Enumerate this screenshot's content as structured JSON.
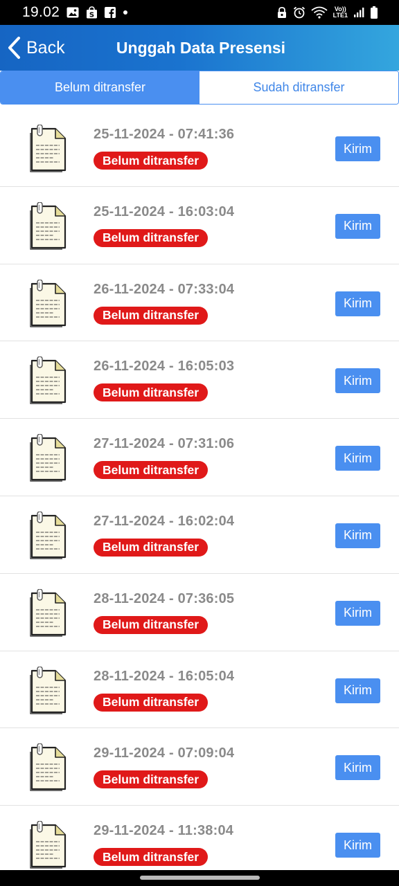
{
  "status_bar": {
    "time": "19.02",
    "network_label_top": "Vo))",
    "network_label_bottom": "LTE1",
    "icons": [
      "gallery-icon",
      "shop-icon",
      "facebook-icon",
      "dot-icon",
      "lock-icon",
      "alarm-icon",
      "wifi-icon",
      "signal-icon",
      "battery-icon"
    ]
  },
  "header": {
    "back_label": "Back",
    "title": "Unggah Data Presensi",
    "background_colors": [
      "#1665c3",
      "#34a6de"
    ]
  },
  "tabs": [
    {
      "label": "Belum ditransfer",
      "active": true
    },
    {
      "label": "Sudah ditransfer",
      "active": false
    }
  ],
  "colors": {
    "accent": "#4a8ff0",
    "badge_red": "#e01919",
    "time_gray": "#8a8a8a"
  },
  "rows": [
    {
      "datetime": "25-11-2024 - 07:41:36",
      "status": "Belum ditransfer",
      "action": "Kirim"
    },
    {
      "datetime": "25-11-2024 - 16:03:04",
      "status": "Belum ditransfer",
      "action": "Kirim"
    },
    {
      "datetime": "26-11-2024 - 07:33:04",
      "status": "Belum ditransfer",
      "action": "Kirim"
    },
    {
      "datetime": "26-11-2024 - 16:05:03",
      "status": "Belum ditransfer",
      "action": "Kirim"
    },
    {
      "datetime": "27-11-2024 - 07:31:06",
      "status": "Belum ditransfer",
      "action": "Kirim"
    },
    {
      "datetime": "27-11-2024 - 16:02:04",
      "status": "Belum ditransfer",
      "action": "Kirim"
    },
    {
      "datetime": "28-11-2024 - 07:36:05",
      "status": "Belum ditransfer",
      "action": "Kirim"
    },
    {
      "datetime": "28-11-2024 - 16:05:04",
      "status": "Belum ditransfer",
      "action": "Kirim"
    },
    {
      "datetime": "29-11-2024 - 07:09:04",
      "status": "Belum ditransfer",
      "action": "Kirim"
    },
    {
      "datetime": "29-11-2024 - 11:38:04",
      "status": "Belum ditransfer",
      "action": "Kirim"
    }
  ]
}
